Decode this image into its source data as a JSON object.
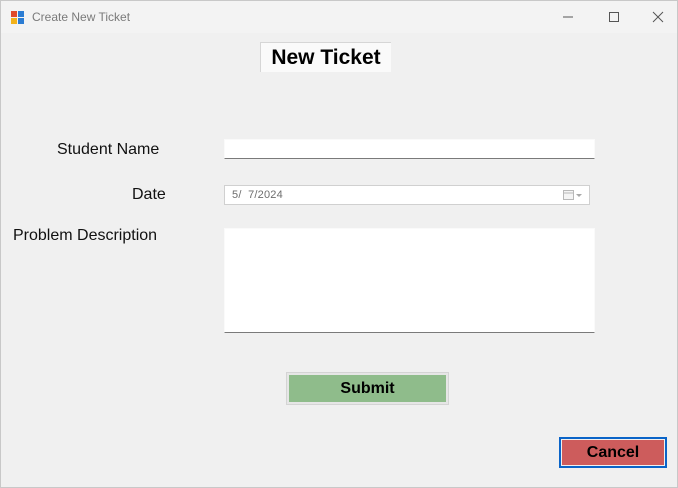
{
  "window": {
    "title": "Create New Ticket",
    "controls": [
      "minimize-icon",
      "maximize-icon",
      "close-icon"
    ]
  },
  "form": {
    "heading": "New Ticket",
    "student_name": {
      "label": "Student Name",
      "value": ""
    },
    "date": {
      "label": "Date",
      "value": "5/  7/2024",
      "icon": "calendar-dropdown-icon"
    },
    "problem_description": {
      "label": "Problem Description",
      "value": ""
    },
    "submit_label": "Submit",
    "cancel_label": "Cancel"
  },
  "colors": {
    "submit_bg": "#8fbc8b",
    "cancel_bg": "#cd5c5c",
    "focus_border": "#0a64c8"
  }
}
